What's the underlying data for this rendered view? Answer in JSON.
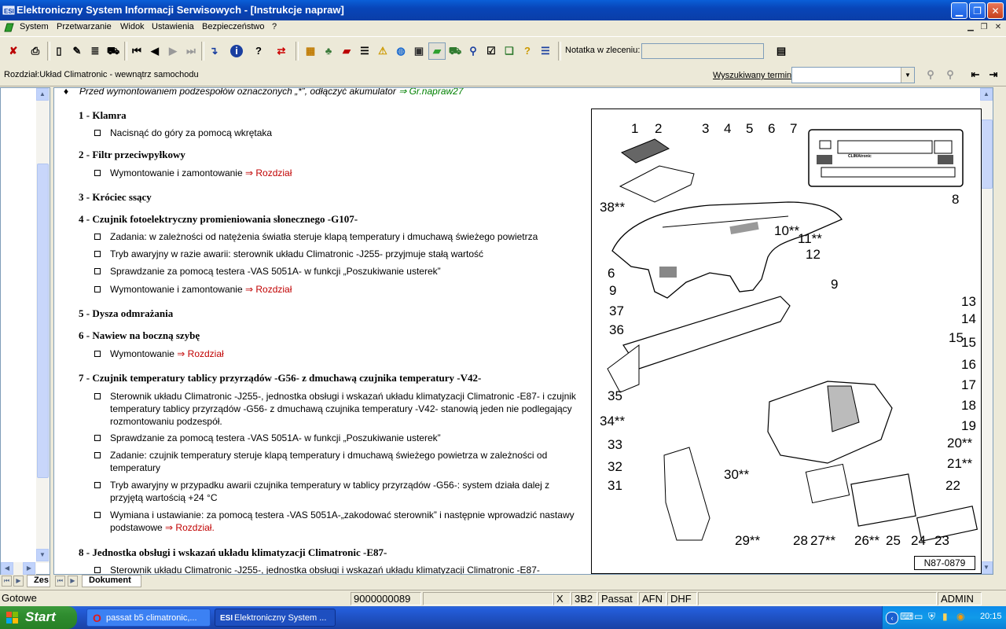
{
  "window": {
    "app_icon": "app-logo-icon",
    "title": "Elektroniczny System Informacji Serwisowych - [Instrukcje napraw]",
    "controls": [
      "minimize-icon",
      "restore-icon",
      "close-icon"
    ]
  },
  "menu": {
    "items": [
      "System",
      "Przetwarzanie",
      "Widok",
      "Ustawienia",
      "Bezpieczeństwo",
      "?"
    ],
    "mdi_controls": [
      "minimize-icon",
      "restore-icon",
      "close-icon"
    ]
  },
  "toolbar": {
    "note_label": "Notatka w zleceniu:",
    "note_value": ""
  },
  "infobar": {
    "section": "Rozdział:Układ Climatronic - wewnątrz samochodu",
    "search_label": "Wyszukiwany termin",
    "search_value": ""
  },
  "doc": {
    "intro": {
      "text": "Przed wymontowaniem podzespołów oznaczonych „*”, odłączyć akumulator ",
      "link": "⇒ Gr.napraw27"
    },
    "items": [
      {
        "heading": "1 - Klamra",
        "bullets": [
          {
            "text": "Nacisnąć do góry za pomocą wkrętaka",
            "link": ""
          }
        ]
      },
      {
        "heading": "2 - Filtr przeciwpyłkowy",
        "bullets": [
          {
            "text": "Wymontowanie i zamontowanie ",
            "link": "⇒ Rozdział"
          }
        ]
      },
      {
        "heading": "3 - Króciec ssący",
        "bullets": []
      },
      {
        "heading": "4 - Czujnik fotoelektryczny promieniowania słonecznego -G107-",
        "bullets": [
          {
            "text": "Zadania: w zależności od natężenia światła steruje klapą temperatury i dmuchawą świeżego powietrza",
            "link": ""
          },
          {
            "text": "Tryb awaryjny w razie awarii: sterownik układu Climatronic -J255- przyjmuje stałą wartość",
            "link": ""
          },
          {
            "text": "Sprawdzanie za pomocą testera -VAS 5051A- w funkcji „Poszukiwanie usterek”",
            "link": ""
          },
          {
            "text": "Wymontowanie i zamontowanie ",
            "link": "⇒ Rozdział"
          }
        ]
      },
      {
        "heading": "5 - Dysza odmrażania",
        "bullets": []
      },
      {
        "heading": "6 - Nawiew na boczną szybę",
        "bullets": [
          {
            "text": "Wymontowanie ",
            "link": "⇒ Rozdział"
          }
        ]
      },
      {
        "heading": "7 - Czujnik temperatury tablicy przyrządów -G56- z dmuchawą czujnika temperatury -V42-",
        "bullets": [
          {
            "text": "Sterownik układu Climatronic -J255-, jednostka obsługi i wskazań układu klimatyzacji Climatronic -E87- i czujnik temperatury tablicy przyrządów -G56- z dmuchawą czujnika temperatury -V42- stanowią jeden nie podlegający rozmontowaniu podzespół.",
            "link": ""
          },
          {
            "text": "Sprawdzanie za pomocą testera -VAS 5051A- w funkcji „Poszukiwanie usterek”",
            "link": ""
          },
          {
            "text": "Zadanie: czujnik temperatury steruje klapą temperatury i dmuchawą świeżego powietrza w zależności od temperatury",
            "link": ""
          },
          {
            "text": "Tryb awaryjny w przypadku awarii czujnika temperatury w tablicy przyrządów -G56-: system działa dalej z przyjętą wartością +24 °C",
            "link": ""
          },
          {
            "text": "Wymiana i ustawianie: za pomocą testera -VAS 5051A-„zakodować sterownik” i następnie wprowadzić nastawy podstawowe ",
            "link": "⇒ Rozdział."
          }
        ]
      },
      {
        "heading": "8 - Jednostka obsługi i wskazań układu klimatyzacji Climatronic -E87-",
        "bullets": [
          {
            "text": "Sterownik układu Climatronic -J255-, jednostka obsługi i wskazań układu klimatyzacji Climatronic -E87-",
            "link": ""
          }
        ]
      }
    ]
  },
  "diagram": {
    "image_code": "N87-0879",
    "labels": [
      "1",
      "2",
      "3",
      "4",
      "5",
      "6",
      "7",
      "8",
      "9",
      "10**",
      "11**",
      "12",
      "13",
      "14",
      "15",
      "15",
      "16",
      "17",
      "18",
      "19",
      "20**",
      "21**",
      "22",
      "23",
      "24",
      "25",
      "26**",
      "27**",
      "28",
      "29**",
      "30**",
      "31",
      "32",
      "33",
      "34**",
      "35",
      "36",
      "37",
      "38**",
      "6",
      "9"
    ],
    "panel_text": "CLIMAtronic"
  },
  "tabs": {
    "left_tab": "Zes",
    "right_tab": "Dokument"
  },
  "status": {
    "text": "Gotowe",
    "order": "9000000089",
    "cells": [
      "X",
      "3B2",
      "Passat",
      "AFN",
      "DHF",
      "",
      "ADMIN"
    ]
  },
  "taskbar": {
    "start": "Start",
    "tasks": [
      {
        "label": "passat b5 climatronic,...",
        "icon": "opera-icon"
      },
      {
        "label": "Elektroniczny System ...",
        "icon": "app-logo-icon"
      }
    ],
    "clock": "20:15"
  }
}
